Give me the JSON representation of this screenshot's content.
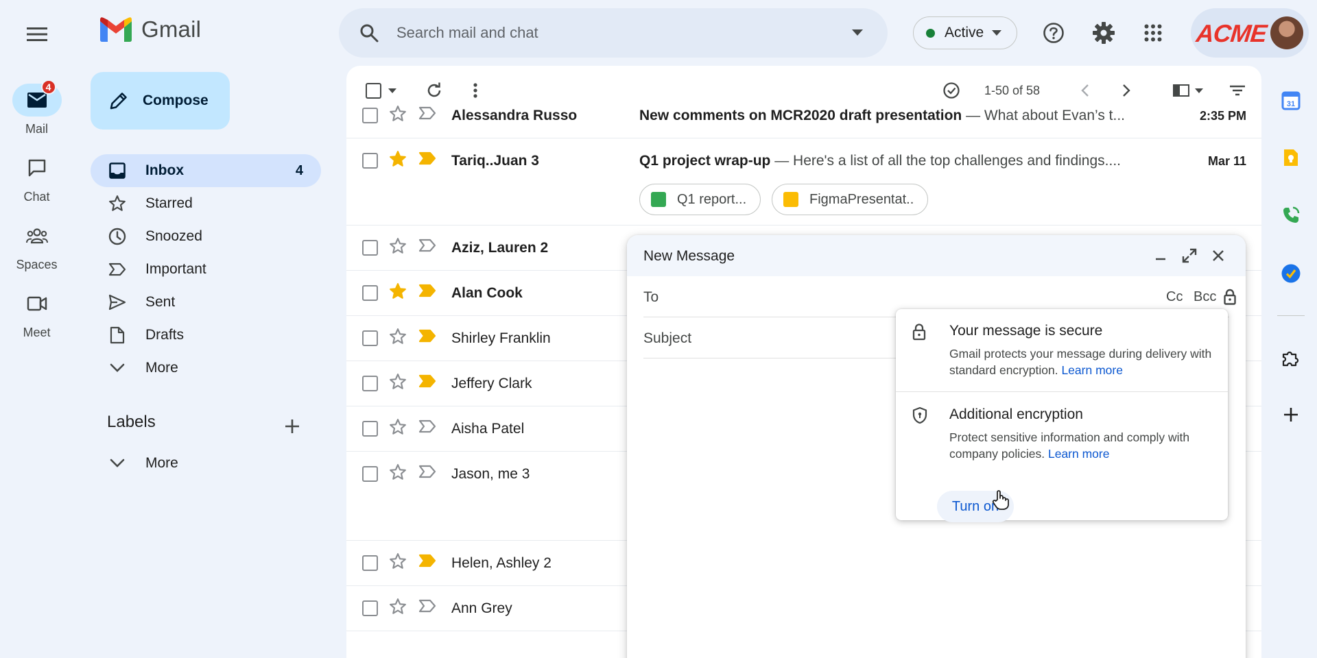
{
  "app": {
    "name": "Gmail"
  },
  "rail": {
    "items": [
      {
        "label": "Mail",
        "badge": "4",
        "icon": "mail-icon"
      },
      {
        "label": "Chat",
        "icon": "chat-icon"
      },
      {
        "label": "Spaces",
        "icon": "spaces-icon"
      },
      {
        "label": "Meet",
        "icon": "meet-icon"
      }
    ]
  },
  "search": {
    "placeholder": "Search mail and chat"
  },
  "status": {
    "label": "Active",
    "color": "#188038"
  },
  "brand": {
    "logo_text": "ACME",
    "color": "#e8332a"
  },
  "compose_button": {
    "label": "Compose"
  },
  "nav": {
    "items": [
      {
        "label": "Inbox",
        "count": "4",
        "icon": "inbox-icon"
      },
      {
        "label": "Starred",
        "count": "",
        "icon": "star-icon"
      },
      {
        "label": "Snoozed",
        "count": "",
        "icon": "clock-icon"
      },
      {
        "label": "Important",
        "count": "",
        "icon": "important-icon"
      },
      {
        "label": "Sent",
        "count": "",
        "icon": "send-icon"
      },
      {
        "label": "Drafts",
        "count": "",
        "icon": "draft-icon"
      },
      {
        "label": "More",
        "count": "",
        "icon": "chevron-down-icon"
      }
    ],
    "labels_heading": "Labels",
    "labels_more": "More"
  },
  "toolbar": {
    "pagination": "1-50 of 58"
  },
  "emails": [
    {
      "sender": "Alessandra Russo",
      "subject": "New comments on MCR2020 draft presentation",
      "snippet": " — What about Evan’s t...",
      "date": "2:35 PM",
      "starred": false,
      "important": false,
      "unread": true
    },
    {
      "sender": "Tariq..Juan 3",
      "subject": "Q1 project wrap-up",
      "snippet": " — Here's a list of all the top challenges and findings....",
      "date": "Mar 11",
      "starred": true,
      "important": true,
      "unread": true,
      "attachments": [
        "Q1 report...",
        "FigmaPresentat.."
      ]
    },
    {
      "sender": "Aziz, Lauren 2",
      "subject": "",
      "snippet": "",
      "date": "",
      "starred": false,
      "important": false,
      "unread": true
    },
    {
      "sender": "Alan Cook",
      "subject": "",
      "snippet": "",
      "date": "",
      "starred": true,
      "important": true,
      "unread": true
    },
    {
      "sender": "Shirley Franklin",
      "subject": "",
      "snippet": "",
      "date": "",
      "starred": false,
      "important": true,
      "unread": false
    },
    {
      "sender": "Jeffery Clark",
      "subject": "",
      "snippet": "",
      "date": "",
      "starred": false,
      "important": true,
      "unread": false
    },
    {
      "sender": "Aisha Patel",
      "subject": "",
      "snippet": "",
      "date": "",
      "starred": false,
      "important": false,
      "unread": false
    },
    {
      "sender": "Jason, me 3",
      "subject": "",
      "snippet": "",
      "date": "",
      "starred": false,
      "important": false,
      "unread": false
    },
    {
      "sender": "Helen, Ashley 2",
      "subject": "",
      "snippet": "",
      "date": "",
      "starred": false,
      "important": true,
      "unread": false
    },
    {
      "sender": "Ann Grey",
      "subject": "",
      "snippet": "",
      "date": "",
      "starred": false,
      "important": false,
      "unread": false
    }
  ],
  "compose_window": {
    "title": "New Message",
    "to_label": "To",
    "cc_label": "Cc",
    "bcc_label": "Bcc",
    "subject_label": "Subject"
  },
  "security_popover": {
    "secure_title": "Your message is secure",
    "secure_body": "Gmail protects your message during delivery with standard encryption.",
    "learn_more_1": "Learn more",
    "encryption_title": "Additional encryption",
    "encryption_body": "Protect sensitive information and comply with company policies.",
    "learn_more_2": "Learn more",
    "turn_on_label": "Turn on"
  },
  "colors": {
    "accent": "#0b57d0",
    "star": "#f4b400",
    "important": "#f4b400",
    "badge": "#d93025"
  }
}
